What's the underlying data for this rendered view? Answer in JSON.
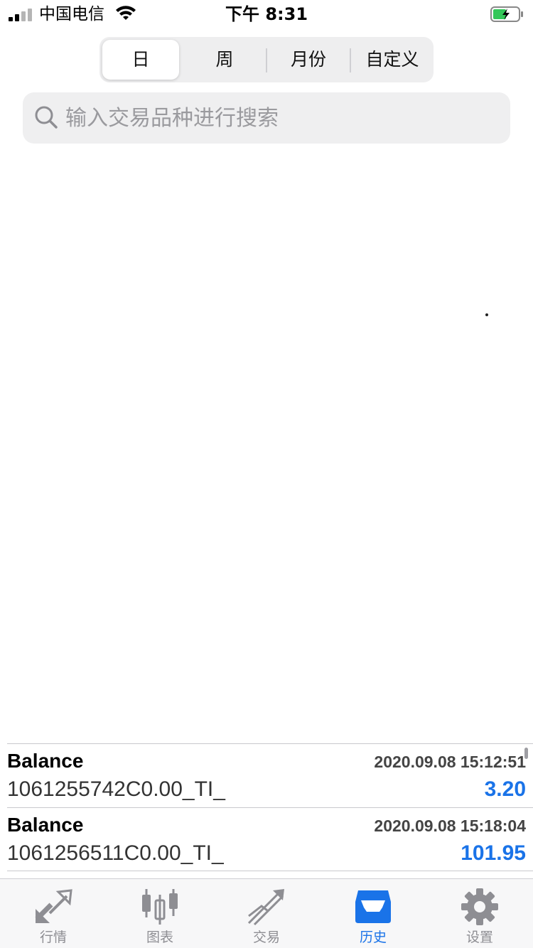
{
  "status_bar": {
    "carrier": "中国电信",
    "time": "下午 8:31",
    "battery_color": "#34c759"
  },
  "segments": [
    {
      "label": "日",
      "active": true
    },
    {
      "label": "周",
      "active": false
    },
    {
      "label": "月份",
      "active": false
    },
    {
      "label": "自定义",
      "active": false
    }
  ],
  "search": {
    "placeholder": "输入交易品种进行搜索",
    "value": ""
  },
  "history": [
    {
      "type": "Balance",
      "time": "2020.09.08 15:12:51",
      "comment": "1061255742C0.00_TI_",
      "amount": "3.20"
    },
    {
      "type": "Balance",
      "time": "2020.09.08 15:18:04",
      "comment": "1061256511C0.00_TI_",
      "amount": "101.95"
    }
  ],
  "tabs": [
    {
      "label": "行情",
      "icon": "quotes-arrows-icon",
      "active": false
    },
    {
      "label": "图表",
      "icon": "candlestick-chart-icon",
      "active": false
    },
    {
      "label": "交易",
      "icon": "trade-trend-icon",
      "active": false
    },
    {
      "label": "历史",
      "icon": "history-inbox-icon",
      "active": true
    },
    {
      "label": "设置",
      "icon": "settings-gear-icon",
      "active": false
    }
  ],
  "colors": {
    "accent": "#1a73e8",
    "inactive_tab": "#8e8e93",
    "amount_positive": "#1a73e8"
  }
}
